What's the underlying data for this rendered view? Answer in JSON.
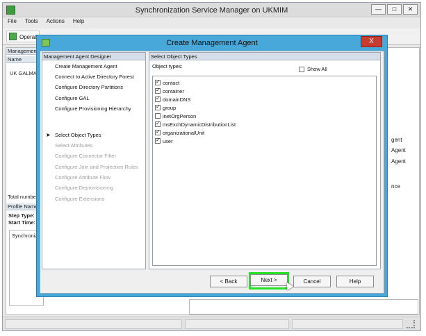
{
  "main_window": {
    "title": "Synchronization Service Manager on UKMIM",
    "menu": [
      "File",
      "Tools",
      "Actions",
      "Help"
    ],
    "toolbar_button": "Operat",
    "left_header": "Management",
    "column_name": "Name",
    "row_name": "UK GALMA",
    "total_label": "Total number",
    "profile_label": "Profile Name",
    "step_type_label": "Step Type:",
    "start_time_label": "Start Time:",
    "sync_label": "Synchroniz",
    "right_fragments": [
      "gent",
      "Agent",
      "Agent",
      "nce"
    ]
  },
  "dialog": {
    "title": "Create Management Agent",
    "close_glyph": "X",
    "left_panel": {
      "header": "Management Agent Designer",
      "items": [
        {
          "label": "Create Management Agent",
          "enabled": true
        },
        {
          "label": "Connect to Active Directory Forest",
          "enabled": true
        },
        {
          "label": "Configure Directory Partitions",
          "enabled": true
        },
        {
          "label": "Configure GAL",
          "enabled": true
        },
        {
          "label": "Configure Provisioning Hierarchy",
          "enabled": true
        },
        {
          "label": "Select Object Types",
          "enabled": true,
          "current": true
        },
        {
          "label": "Select Attributes",
          "enabled": false
        },
        {
          "label": "Configure Connector Filter",
          "enabled": false
        },
        {
          "label": "Configure Join and Projection Rules",
          "enabled": false
        },
        {
          "label": "Configure Attribute Flow",
          "enabled": false
        },
        {
          "label": "Configure Deprovisioning",
          "enabled": false
        },
        {
          "label": "Configure Extensions",
          "enabled": false
        }
      ]
    },
    "right_panel": {
      "header": "Select Object Types",
      "object_types_label": "Object types:",
      "show_all_label": "Show All",
      "show_all_checked": false,
      "object_types": [
        {
          "name": "contact",
          "checked": true
        },
        {
          "name": "container",
          "checked": true
        },
        {
          "name": "domainDNS",
          "checked": true
        },
        {
          "name": "group",
          "checked": true
        },
        {
          "name": "inetOrgPerson",
          "checked": false
        },
        {
          "name": "msExchDynamicDistributionList",
          "checked": true
        },
        {
          "name": "organizationalUnit",
          "checked": true
        },
        {
          "name": "user",
          "checked": true
        }
      ]
    },
    "buttons": {
      "back": "< Back",
      "next": "Next >",
      "cancel": "Cancel",
      "help": "Help"
    },
    "highlight_color": "#22e022"
  }
}
